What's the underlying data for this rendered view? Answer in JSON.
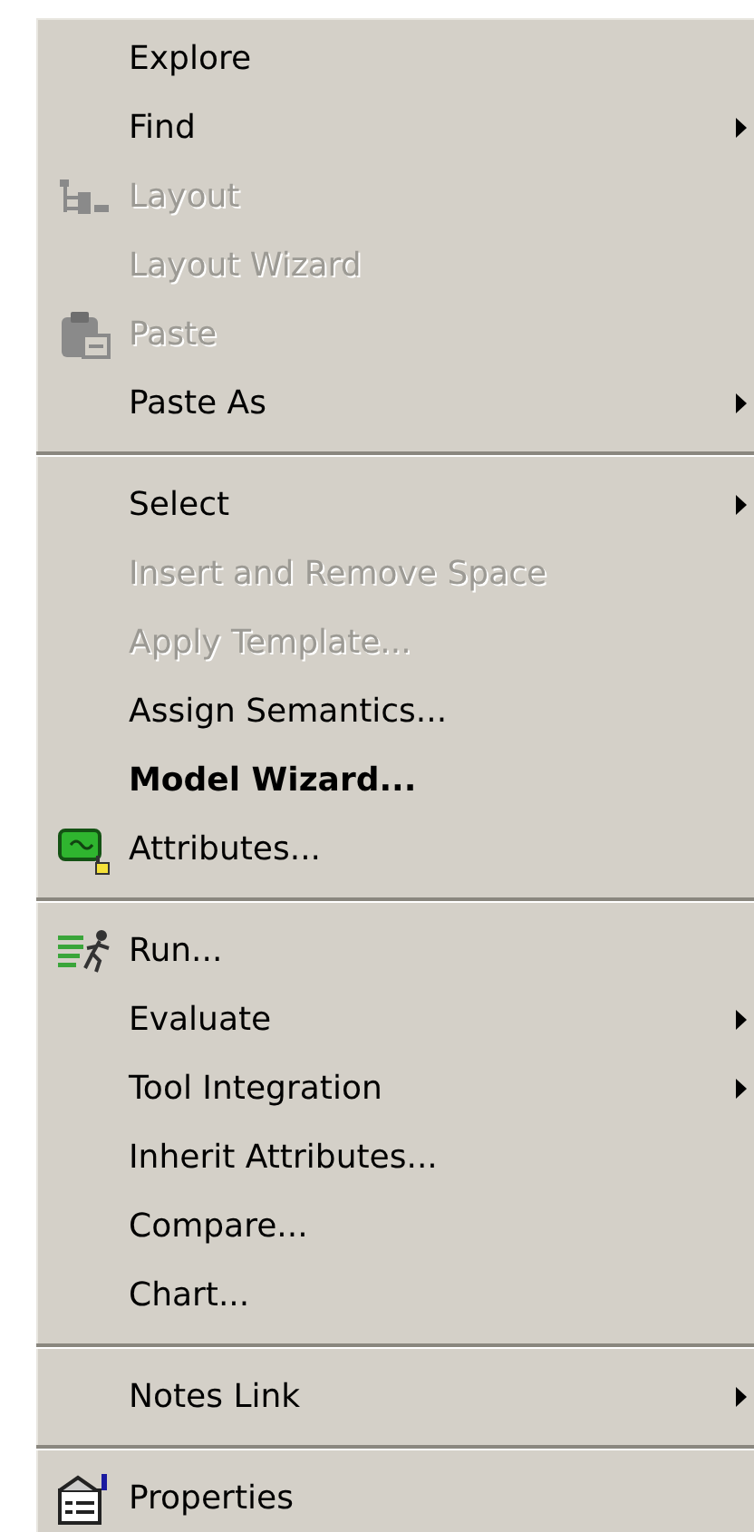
{
  "menu": {
    "sections": [
      {
        "items": [
          {
            "label": "Explore",
            "kind": "plain",
            "disabled": false,
            "bold": false,
            "submenu": false
          },
          {
            "label": "Find",
            "kind": "plain",
            "disabled": false,
            "bold": false,
            "submenu": true
          },
          {
            "label": "Layout",
            "kind": "layout",
            "disabled": true,
            "bold": false,
            "submenu": false
          },
          {
            "label": "Layout Wizard",
            "kind": "plain",
            "disabled": true,
            "bold": false,
            "submenu": false
          },
          {
            "label": "Paste",
            "kind": "paste",
            "disabled": true,
            "bold": false,
            "submenu": false
          },
          {
            "label": "Paste As",
            "kind": "plain",
            "disabled": false,
            "bold": false,
            "submenu": true
          }
        ]
      },
      {
        "items": [
          {
            "label": "Select",
            "kind": "plain",
            "disabled": false,
            "bold": false,
            "submenu": true
          },
          {
            "label": "Insert and Remove Space",
            "kind": "plain",
            "disabled": true,
            "bold": false,
            "submenu": false
          },
          {
            "label": "Apply Template...",
            "kind": "plain",
            "disabled": true,
            "bold": false,
            "submenu": false
          },
          {
            "label": "Assign Semantics...",
            "kind": "plain",
            "disabled": false,
            "bold": false,
            "submenu": false
          },
          {
            "label": "Model Wizard...",
            "kind": "plain",
            "disabled": false,
            "bold": true,
            "submenu": false
          },
          {
            "label": "Attributes...",
            "kind": "attributes",
            "disabled": false,
            "bold": false,
            "submenu": false
          }
        ]
      },
      {
        "items": [
          {
            "label": "Run...",
            "kind": "run",
            "disabled": false,
            "bold": false,
            "submenu": false
          },
          {
            "label": "Evaluate",
            "kind": "plain",
            "disabled": false,
            "bold": false,
            "submenu": true
          },
          {
            "label": "Tool Integration",
            "kind": "plain",
            "disabled": false,
            "bold": false,
            "submenu": true
          },
          {
            "label": "Inherit Attributes...",
            "kind": "plain",
            "disabled": false,
            "bold": false,
            "submenu": false
          },
          {
            "label": "Compare...",
            "kind": "plain",
            "disabled": false,
            "bold": false,
            "submenu": false
          },
          {
            "label": "Chart...",
            "kind": "plain",
            "disabled": false,
            "bold": false,
            "submenu": false
          }
        ]
      },
      {
        "items": [
          {
            "label": "Notes Link",
            "kind": "plain",
            "disabled": false,
            "bold": false,
            "submenu": true
          }
        ]
      },
      {
        "items": [
          {
            "label": "Properties",
            "kind": "properties",
            "disabled": false,
            "bold": false,
            "submenu": false
          }
        ]
      }
    ]
  }
}
